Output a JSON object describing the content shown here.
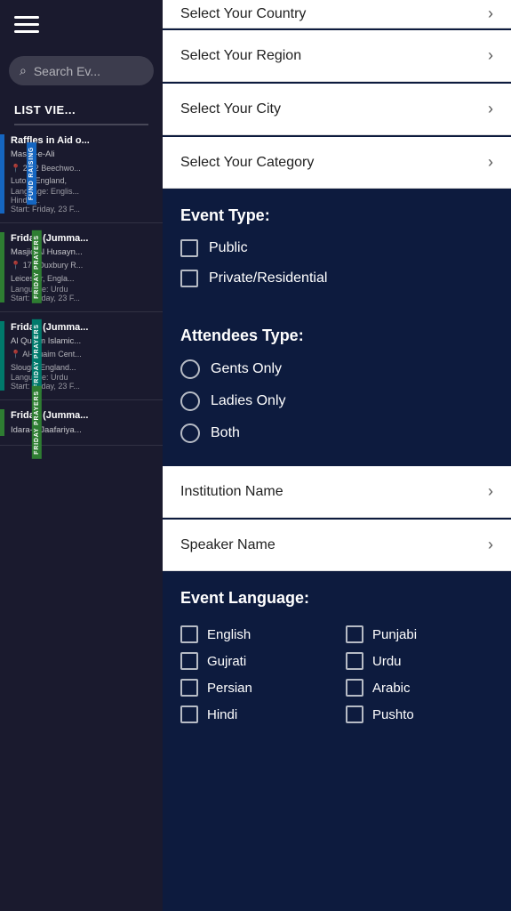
{
  "leftPanel": {
    "searchPlaceholder": "Search Ev...",
    "listViewLabel": "LIST VIE...",
    "events": [
      {
        "id": 1,
        "barColor": "bar-blue",
        "tagColor": "side-tag",
        "tagText": "FUND RAISING",
        "title": "Raffles in Aid o...",
        "venue": "Masjid-e-Ali",
        "address": "2-32 Beechwo...",
        "city": "Luton, England,",
        "language": "Language: Englis... Hindi, ...",
        "start": "Start: Friday, 23 F..."
      },
      {
        "id": 2,
        "barColor": "bar-green",
        "tagColor": "side-tag side-tag-green",
        "tagText": "FRIDAY PRAYERS",
        "title": "Friday (Jumma...",
        "venue": "Masjid Al Husayn...",
        "address": "17a Duxbury R...",
        "city": "Leicester, Engla...",
        "language": "Language: Urdu",
        "start": "Start: Friday, 23 F..."
      },
      {
        "id": 3,
        "barColor": "bar-teal",
        "tagColor": "side-tag side-tag-teal",
        "tagText": "FRIDAY PRAYERS",
        "title": "Friday (Jumma...",
        "venue": "Al Quaim Islamic...",
        "address": "Al-Quaim Cent...",
        "city": "Slough, England...",
        "language": "Language: Urdu",
        "start": "Start: Friday, 23 F..."
      },
      {
        "id": 4,
        "barColor": "bar-green",
        "tagColor": "side-tag side-tag-green",
        "tagText": "FRIDAY PRAYERS",
        "title": "Friday (Jumma...",
        "venue": "Idara-e-Jaafariya...",
        "address": "",
        "city": "",
        "language": "",
        "start": ""
      }
    ]
  },
  "filterPanel": {
    "rows": [
      {
        "id": "country",
        "label": "Select Your Country"
      },
      {
        "id": "region",
        "label": "Select Your Region"
      },
      {
        "id": "city",
        "label": "Select Your City"
      },
      {
        "id": "category",
        "label": "Select Your Category"
      }
    ],
    "eventTypeSection": {
      "title": "Event Type:",
      "options": [
        {
          "id": "public",
          "label": "Public"
        },
        {
          "id": "private",
          "label": "Private/Residential"
        }
      ]
    },
    "attendeesTypeSection": {
      "title": "Attendees Type:",
      "options": [
        {
          "id": "gents",
          "label": "Gents Only"
        },
        {
          "id": "ladies",
          "label": "Ladies Only"
        },
        {
          "id": "both",
          "label": "Both"
        }
      ]
    },
    "institutionRow": {
      "label": "Institution Name"
    },
    "speakerRow": {
      "label": "Speaker Name"
    },
    "eventLanguageSection": {
      "title": "Event Language:",
      "languages": [
        {
          "id": "english",
          "label": "English"
        },
        {
          "id": "punjabi",
          "label": "Punjabi"
        },
        {
          "id": "gujrati",
          "label": "Gujrati"
        },
        {
          "id": "urdu",
          "label": "Urdu"
        },
        {
          "id": "persian",
          "label": "Persian"
        },
        {
          "id": "arabic",
          "label": "Arabic"
        },
        {
          "id": "hindi",
          "label": "Hindi"
        },
        {
          "id": "pushto",
          "label": "Pushto"
        }
      ]
    }
  },
  "colors": {
    "filterPanelBg": "#0d1b3e",
    "leftPanelBg": "#1a1a2e",
    "white": "#ffffff",
    "barBlue": "#1565c0",
    "barGreen": "#2e7d32",
    "barTeal": "#00796b"
  }
}
